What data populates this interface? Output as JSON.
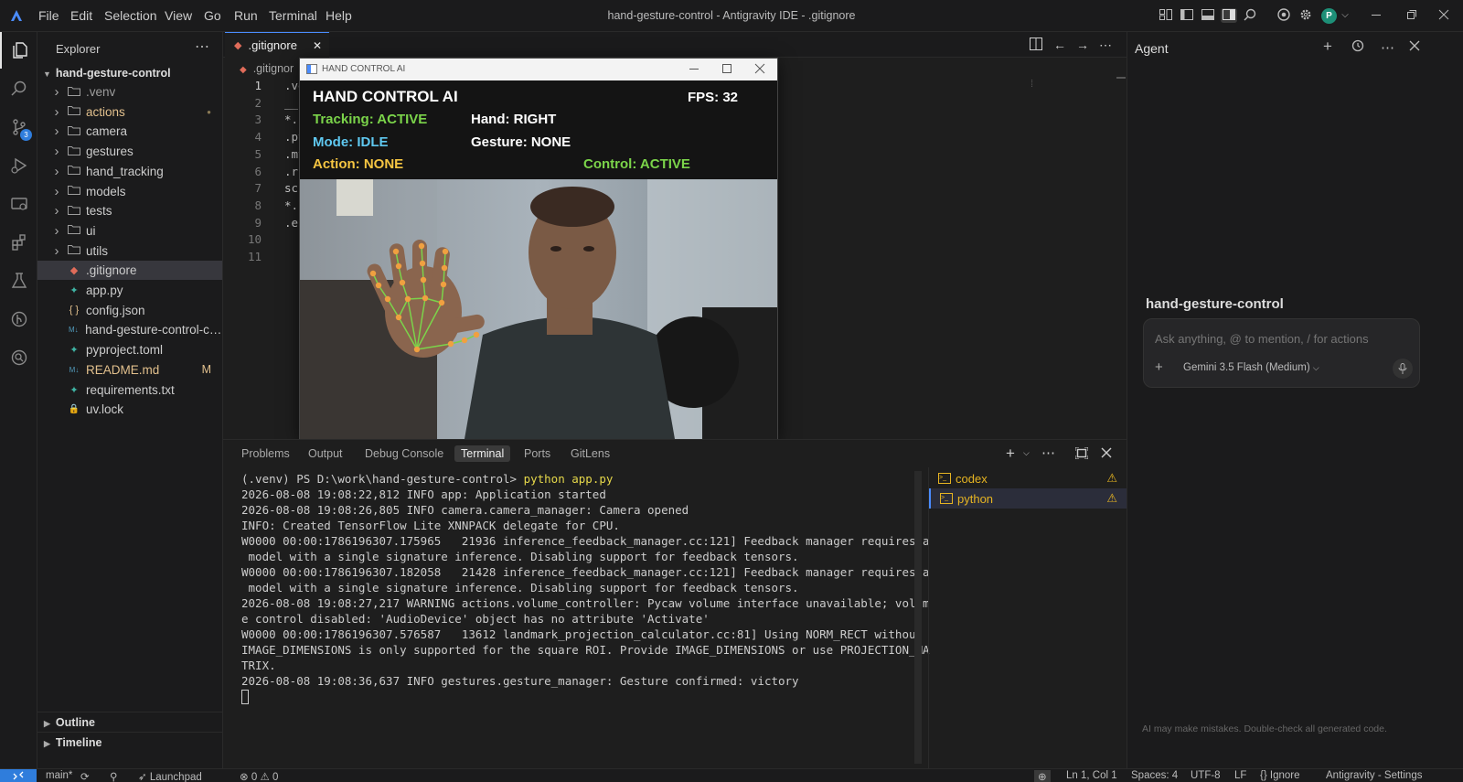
{
  "window": {
    "title": "hand-gesture-control - Antigravity IDE - .gitignore"
  },
  "menu": [
    "File",
    "Edit",
    "Selection",
    "View",
    "Go",
    "Run",
    "Terminal",
    "Help"
  ],
  "user": {
    "avatar_letter": "P"
  },
  "activity": {
    "scm_badge": "3"
  },
  "explorer": {
    "title": "Explorer",
    "root": "hand-gesture-control",
    "items": [
      {
        "name": ".venv",
        "type": "folder",
        "color": "#9d9d9d"
      },
      {
        "name": "actions",
        "type": "folder",
        "color": "#e2c08d",
        "mark": "●"
      },
      {
        "name": "camera",
        "type": "folder"
      },
      {
        "name": "gestures",
        "type": "folder"
      },
      {
        "name": "hand_tracking",
        "type": "folder"
      },
      {
        "name": "models",
        "type": "folder"
      },
      {
        "name": "tests",
        "type": "folder"
      },
      {
        "name": "ui",
        "type": "folder"
      },
      {
        "name": "utils",
        "type": "folder"
      },
      {
        "name": ".gitignore",
        "type": "file",
        "icon": "git-icon",
        "selected": true
      },
      {
        "name": "app.py",
        "type": "file",
        "icon": "python-icon"
      },
      {
        "name": "config.json",
        "type": "file",
        "icon": "json-icon"
      },
      {
        "name": "hand-gesture-control-co...",
        "type": "file",
        "icon": "markdown-icon"
      },
      {
        "name": "pyproject.toml",
        "type": "file",
        "icon": "python-icon"
      },
      {
        "name": "README.md",
        "type": "file",
        "icon": "markdown-icon",
        "color": "#e2c08d",
        "mark": "M"
      },
      {
        "name": "requirements.txt",
        "type": "file",
        "icon": "python-icon"
      },
      {
        "name": "uv.lock",
        "type": "file",
        "icon": "lock-icon"
      }
    ],
    "outline": "Outline",
    "timeline": "Timeline"
  },
  "editor": {
    "tab": ".gitignore",
    "breadcrumb": ".gitignor",
    "lines": [
      {
        "n": "1",
        "text": ".ve"
      },
      {
        "n": "2",
        "text": "__"
      },
      {
        "n": "3",
        "text": "*.p"
      },
      {
        "n": "4",
        "text": ".py"
      },
      {
        "n": "5",
        "text": ".my"
      },
      {
        "n": "6",
        "text": ".ru"
      },
      {
        "n": "7",
        "text": "sc"
      },
      {
        "n": "8",
        "text": "*.l"
      },
      {
        "n": "9",
        "text": ".en"
      },
      {
        "n": "10",
        "text": ""
      },
      {
        "n": "11",
        "text": ""
      }
    ]
  },
  "hand_control": {
    "window_title": "HAND CONTROL AI",
    "heading": "HAND CONTROL AI",
    "fps": "FPS: 32",
    "tracking": "Tracking: ACTIVE",
    "hand": "Hand: RIGHT",
    "mode": "Mode: IDLE",
    "gesture": "Gesture: NONE",
    "action": "Action: NONE",
    "control": "Control: ACTIVE",
    "colors": {
      "green": "#7bd44a",
      "blue": "#5fc8f0",
      "yellow": "#f5c542",
      "white": "#ffffff"
    }
  },
  "panel": {
    "tabs": [
      "Problems",
      "Output",
      "Debug Console",
      "Terminal",
      "Ports",
      "GitLens"
    ],
    "active_tab": "Terminal",
    "terminal": {
      "prompt": "(.venv) PS D:\\work\\hand-gesture-control> ",
      "command": "python app.py",
      "lines": [
        "2026-08-08 19:08:22,812 INFO app: Application started",
        "2026-08-08 19:08:26,805 INFO camera.camera_manager: Camera opened",
        "INFO: Created TensorFlow Lite XNNPACK delegate for CPU.",
        "W0000 00:00:1786196307.175965   21936 inference_feedback_manager.cc:121] Feedback manager requires a",
        " model with a single signature inference. Disabling support for feedback tensors.",
        "W0000 00:00:1786196307.182058   21428 inference_feedback_manager.cc:121] Feedback manager requires a",
        " model with a single signature inference. Disabling support for feedback tensors.",
        "2026-08-08 19:08:27,217 WARNING actions.volume_controller: Pycaw volume interface unavailable; volum",
        "e control disabled: 'AudioDevice' object has no attribute 'Activate'",
        "W0000 00:00:1786196307.576587   13612 landmark_projection_calculator.cc:81] Using NORM_RECT without",
        "IMAGE_DIMENSIONS is only supported for the square ROI. Provide IMAGE_DIMENSIONS or use PROJECTION_MA",
        "TRIX.",
        "2026-08-08 19:08:36,637 INFO gestures.gesture_manager: Gesture confirmed: victory"
      ]
    },
    "terminals": [
      {
        "name": "codex"
      },
      {
        "name": "python",
        "selected": true
      }
    ]
  },
  "agent": {
    "title": "Agent",
    "workspace": "hand-gesture-control",
    "placeholder": "Ask anything, @ to mention, / for actions",
    "model": "Gemini 3.5 Flash (Medium)",
    "disclaimer": "AI may make mistakes. Double-check all generated code."
  },
  "status": {
    "branch": "main*",
    "launchpad": "Launchpad",
    "errors": "0",
    "warnings": "0",
    "position": "Ln 1, Col 1",
    "spaces": "Spaces: 4",
    "encoding": "UTF-8",
    "eol": "LF",
    "language": "Ignore",
    "settings": "Antigravity - Settings"
  }
}
